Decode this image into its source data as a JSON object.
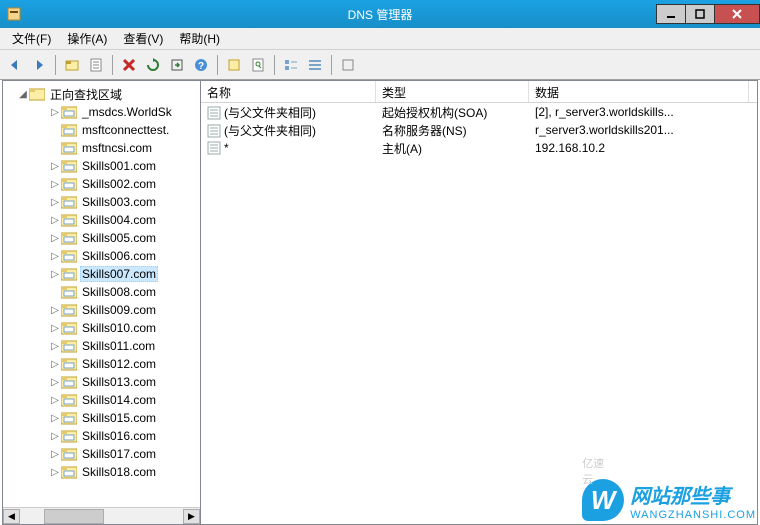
{
  "window": {
    "title": "DNS 管理器"
  },
  "menu": [
    {
      "label": "文件(F)"
    },
    {
      "label": "操作(A)"
    },
    {
      "label": "查看(V)"
    },
    {
      "label": "帮助(H)"
    }
  ],
  "toolbar_icons": [
    "back",
    "forward",
    "up",
    "divider",
    "props",
    "delete",
    "refresh",
    "export",
    "help",
    "divider",
    "filter",
    "search",
    "divider",
    "list1",
    "list2",
    "divider",
    "more"
  ],
  "tree": {
    "root_label": "正向查找区域",
    "items": [
      {
        "label": "_msdcs.WorldSk",
        "depth": 2,
        "expander": "▷"
      },
      {
        "label": "msftconnecttest.",
        "depth": 2,
        "expander": ""
      },
      {
        "label": "msftncsi.com",
        "depth": 2,
        "expander": ""
      },
      {
        "label": "Skills001.com",
        "depth": 2,
        "expander": "▷"
      },
      {
        "label": "Skills002.com",
        "depth": 2,
        "expander": "▷"
      },
      {
        "label": "Skills003.com",
        "depth": 2,
        "expander": "▷"
      },
      {
        "label": "Skills004.com",
        "depth": 2,
        "expander": "▷"
      },
      {
        "label": "Skills005.com",
        "depth": 2,
        "expander": "▷"
      },
      {
        "label": "Skills006.com",
        "depth": 2,
        "expander": "▷"
      },
      {
        "label": "Skills007.com",
        "depth": 2,
        "expander": "▷",
        "selected": true
      },
      {
        "label": "Skills008.com",
        "depth": 2,
        "expander": ""
      },
      {
        "label": "Skills009.com",
        "depth": 2,
        "expander": "▷"
      },
      {
        "label": "Skills010.com",
        "depth": 2,
        "expander": "▷"
      },
      {
        "label": "Skills011.com",
        "depth": 2,
        "expander": "▷"
      },
      {
        "label": "Skills012.com",
        "depth": 2,
        "expander": "▷"
      },
      {
        "label": "Skills013.com",
        "depth": 2,
        "expander": "▷"
      },
      {
        "label": "Skills014.com",
        "depth": 2,
        "expander": "▷"
      },
      {
        "label": "Skills015.com",
        "depth": 2,
        "expander": "▷"
      },
      {
        "label": "Skills016.com",
        "depth": 2,
        "expander": "▷"
      },
      {
        "label": "Skills017.com",
        "depth": 2,
        "expander": "▷"
      },
      {
        "label": "Skills018.com",
        "depth": 2,
        "expander": "▷"
      }
    ]
  },
  "list": {
    "columns": [
      {
        "label": "名称",
        "key": "name"
      },
      {
        "label": "类型",
        "key": "type"
      },
      {
        "label": "数据",
        "key": "data"
      }
    ],
    "rows": [
      {
        "name": "(与父文件夹相同)",
        "type": "起始授权机构(SOA)",
        "data": "[2], r_server3.worldskills..."
      },
      {
        "name": "(与父文件夹相同)",
        "type": "名称服务器(NS)",
        "data": "r_server3.worldskills201..."
      },
      {
        "name": "*",
        "type": "主机(A)",
        "data": "192.168.10.2"
      }
    ]
  },
  "watermark": {
    "yisu": "亿速云",
    "brand_char": "W",
    "brand_text": "网站那些事",
    "brand_sub": "WANGZHANSHI.COM"
  }
}
